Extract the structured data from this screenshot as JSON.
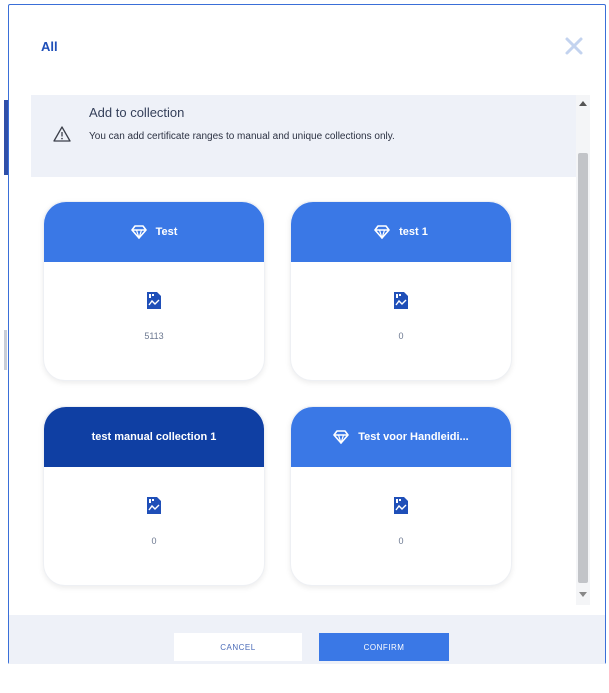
{
  "dialog": {
    "title": "All",
    "close_icon": "close-icon"
  },
  "notice": {
    "icon": "warning-icon",
    "title": "Add to collection",
    "text": "You can add certificate ranges to manual and unique collections only."
  },
  "collections": [
    {
      "name": "Test",
      "count": "5113",
      "icon": "diamond-icon",
      "header_style": "blue"
    },
    {
      "name": "test 1",
      "count": "0",
      "icon": "diamond-icon",
      "header_style": "blue"
    },
    {
      "name": "test manual collection 1",
      "count": "0",
      "icon": "",
      "header_style": "navy"
    },
    {
      "name": "Test voor Handleidi...",
      "count": "0",
      "icon": "diamond-icon",
      "header_style": "blue"
    }
  ],
  "footer": {
    "cancel_label": "CANCEL",
    "confirm_label": "CONFIRM"
  },
  "background_text": "",
  "colors": {
    "accent": "#3a78e6",
    "navy": "#0f3fa3",
    "title": "#1f4fb8"
  }
}
